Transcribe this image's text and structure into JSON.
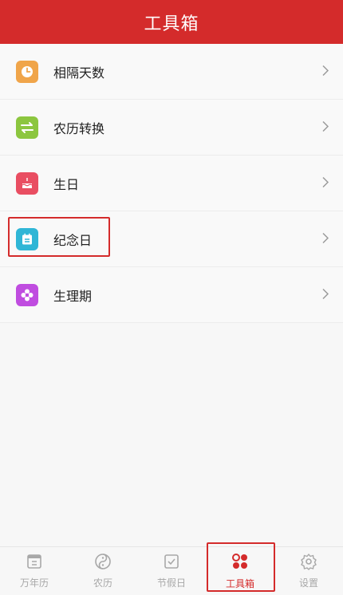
{
  "header": {
    "title": "工具箱"
  },
  "tools": [
    {
      "label": "相隔天数",
      "icon": "clock-icon",
      "color": "#f0a54a"
    },
    {
      "label": "农历转换",
      "icon": "swap-arrows-icon",
      "color": "#8cc63f"
    },
    {
      "label": "生日",
      "icon": "cake-icon",
      "color": "#e94e62"
    },
    {
      "label": "纪念日",
      "icon": "calendar-note-icon",
      "color": "#2fb6d6"
    },
    {
      "label": "生理期",
      "icon": "flower-icon",
      "color": "#c04de0"
    }
  ],
  "tabs": [
    {
      "label": "万年历",
      "icon": "calendar-icon",
      "active": false
    },
    {
      "label": "农历",
      "icon": "yin-yang-icon",
      "active": false
    },
    {
      "label": "节假日",
      "icon": "checklist-icon",
      "active": false
    },
    {
      "label": "工具箱",
      "icon": "toolbox-icon",
      "active": true
    },
    {
      "label": "设置",
      "icon": "gear-icon",
      "active": false
    }
  ],
  "colors": {
    "accent": "#d42b2b",
    "inactive": "#a8a8a8"
  }
}
